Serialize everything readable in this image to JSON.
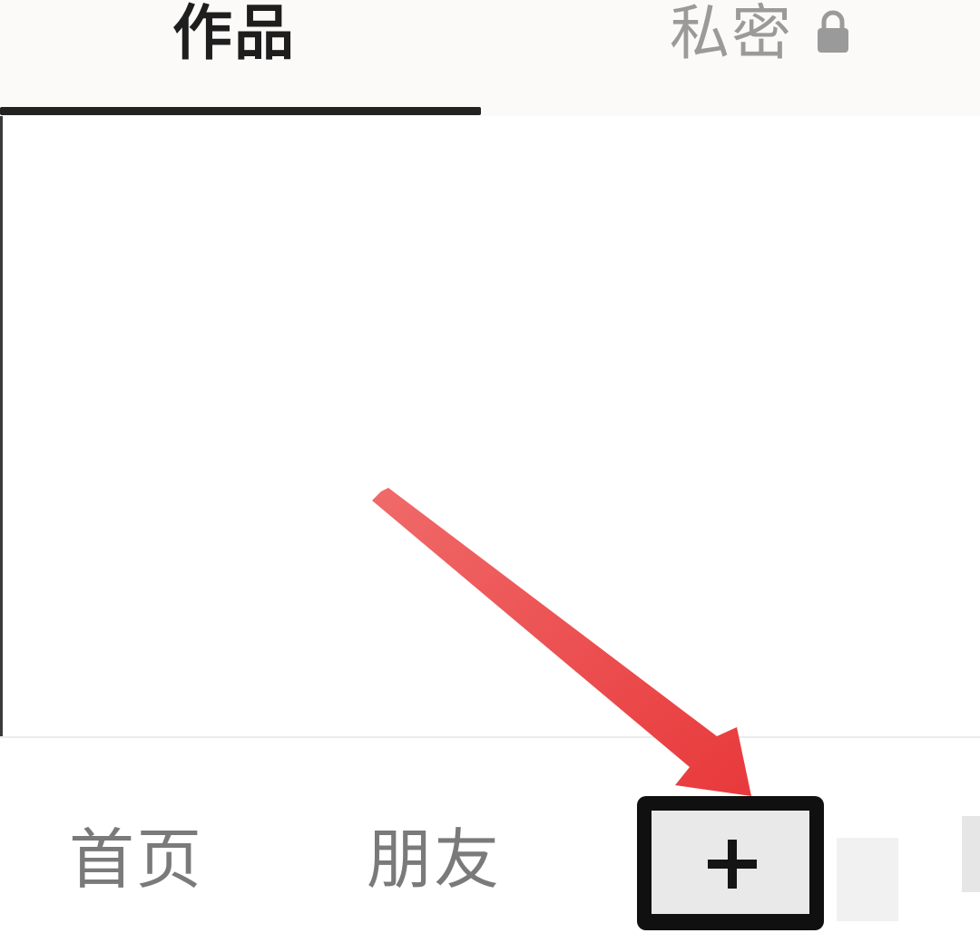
{
  "tabs": {
    "works_label": "作品",
    "private_label": "私密",
    "private_icon": "lock-icon",
    "active_tab": "作品"
  },
  "bottom_nav": {
    "home_label": "首页",
    "friends_label": "朋友",
    "publish_icon": "plus-icon"
  },
  "annotation": {
    "arrow_color": "#e8393b",
    "highlight_box_color": "#101010",
    "arrow_icon": "arrow-icon"
  },
  "colors": {
    "active_text": "#1e1e1e",
    "inactive_text": "#9a9a9a",
    "nav_text": "#7a7a7a"
  }
}
